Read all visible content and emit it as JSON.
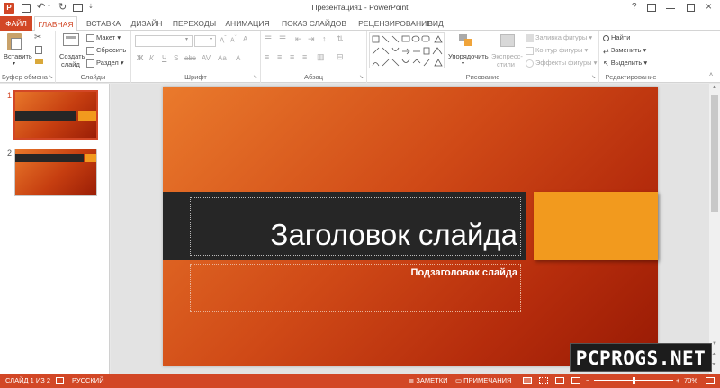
{
  "window": {
    "title": "Презентация1 - PowerPoint",
    "help": "?"
  },
  "tabs": [
    "ФАЙЛ",
    "ГЛАВНАЯ",
    "ВСТАВКА",
    "ДИЗАЙН",
    "ПЕРЕХОДЫ",
    "АНИМАЦИЯ",
    "ПОКАЗ СЛАЙДОВ",
    "РЕЦЕНЗИРОВАНИЕ",
    "ВИД"
  ],
  "ribbon": {
    "clipboard": {
      "label": "Буфер обмена",
      "paste": "Вставить"
    },
    "slides": {
      "label": "Слайды",
      "new_slide_1": "Создать",
      "new_slide_2": "слайд",
      "layout": "Макет",
      "reset": "Сбросить",
      "section": "Раздел"
    },
    "font": {
      "label": "Шрифт"
    },
    "paragraph": {
      "label": "Абзац"
    },
    "drawing": {
      "label": "Рисование",
      "arrange": "Упорядочить",
      "quick_styles_1": "Экспресс-",
      "quick_styles_2": "стили",
      "fill": "Заливка фигуры",
      "outline": "Контур фигуры",
      "effects": "Эффекты фигуры"
    },
    "editing": {
      "label": "Редактирование",
      "find": "Найти",
      "replace": "Заменить",
      "select": "Выделить"
    }
  },
  "thumbnails": [
    {
      "num": "1"
    },
    {
      "num": "2"
    }
  ],
  "slide": {
    "title": "Заголовок слайда",
    "subtitle": "Подзаголовок слайда"
  },
  "status": {
    "slide_info": "СЛАЙД 1 ИЗ 2",
    "language": "РУССКИЙ",
    "notes": "ЗАМЕТКИ",
    "comments": "ПРИМЕЧАНИЯ",
    "zoom": "70%"
  },
  "watermark": "PCPROGS.NET",
  "colors": {
    "accent": "#d24726",
    "title_band": "#262626",
    "orange_block": "#f29a1e"
  }
}
